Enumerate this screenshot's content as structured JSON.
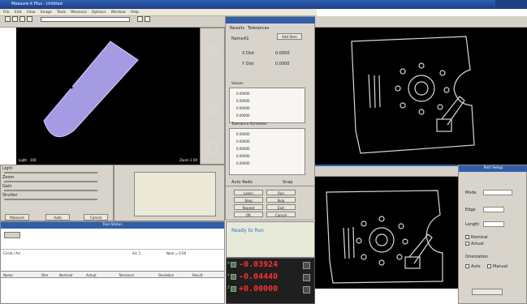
{
  "window": {
    "title": "Measure-X Plus - Untitled"
  },
  "menu": [
    "File",
    "Edit",
    "View",
    "Image",
    "Tools",
    "Measure",
    "Options",
    "Window",
    "Help"
  ],
  "video": {
    "caption_left": "Light : 100",
    "caption_right": "Zoom 1.0X"
  },
  "status_panel": {
    "title": "Tool Status",
    "headers": [
      "Name",
      "Dim",
      "Nominal",
      "Actual",
      "Tolerance",
      "Deviation",
      "Result"
    ],
    "row_label": "Circle / Arc",
    "row_values": [
      "Arc 1",
      "Nom = 0.00"
    ]
  },
  "live": {
    "title": "Ready to Run",
    "x": "-0.03924",
    "y": "-0.04440",
    "z": "+0.00000",
    "x_label": "X",
    "y_label": "Y",
    "z_label": "Z"
  },
  "controls": {
    "labels": [
      "Light",
      "Zoom",
      "Gain",
      "Shutter"
    ],
    "buttons": [
      "Measure",
      "Auto",
      "Cancel"
    ]
  },
  "params": {
    "tab1": "Results",
    "tab2": "Tolerances",
    "name_label": "Name",
    "name_value": "A1",
    "options_button": "Add Item",
    "dim1": "X Dist",
    "dim1_value": "0.0000",
    "dim2": "Y Dist",
    "dim2_value": "0.0000",
    "table1_title": "Values",
    "table1": [
      "0.00000",
      "0.00000",
      "0.00000",
      "0.00000"
    ],
    "table2_title": "Tolerance Schemes",
    "table2": [
      "0.00000",
      "0.00000",
      "0.00000",
      "0.00000",
      "0.00000"
    ],
    "bottom_left": "Auto Redo",
    "bottom_right": "Snap",
    "run_buttons": [
      "Learn",
      "Run",
      "Step",
      "Skip",
      "Repeat",
      "Exit",
      "OK",
      "Cancel"
    ]
  },
  "right_panel": {
    "title": "Part Setup",
    "labels": [
      "Mode",
      "Edge",
      "Length",
      "Orientation"
    ],
    "options": [
      "Nominal",
      "Actual",
      "Auto",
      "Manual"
    ]
  }
}
